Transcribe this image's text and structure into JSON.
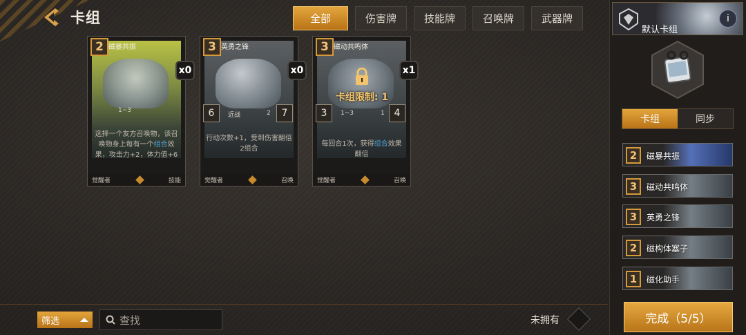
{
  "header": {
    "title": "卡组"
  },
  "tabs": [
    {
      "label": "全部",
      "active": true
    },
    {
      "label": "伤害牌",
      "active": false
    },
    {
      "label": "技能牌",
      "active": false
    },
    {
      "label": "召唤牌",
      "active": false
    },
    {
      "label": "武器牌",
      "active": false
    }
  ],
  "cards": [
    {
      "cost": "2",
      "name": "磁暴共振",
      "count": "x0",
      "range": "1~3",
      "desc_parts": [
        "选择一个友方召唤物，该召唤物身上每有一个",
        "组合",
        "效果，攻击力+2，体力值+6"
      ],
      "class_label": "觉醒者",
      "type_label": "技能"
    },
    {
      "cost": "3",
      "name": "英勇之锋",
      "count": "x0",
      "attack": "6",
      "defense": "7",
      "mode": "近战",
      "num": "2",
      "desc": "行动次数+1，受到伤害翻倍",
      "desc2": "2组合",
      "class_label": "觉醒者",
      "type_label": "召唤"
    },
    {
      "cost": "3",
      "name": "磁动共鸣体",
      "count": "x1",
      "attack": "3",
      "defense": "4",
      "range": "1~3",
      "num": "1",
      "desc_parts": [
        "每回合1次，获得",
        "组合",
        "效果翻倍"
      ],
      "class_label": "觉醒者",
      "type_label": "召唤",
      "lock_text": "卡组限制: 1"
    }
  ],
  "filter": {
    "label": "筛选"
  },
  "search": {
    "placeholder": "查找"
  },
  "unowned_label": "未拥有",
  "panel": {
    "deck_name": "默认卡组",
    "info_label": "i",
    "seg": [
      "卡组",
      "同步"
    ],
    "deck_items": [
      {
        "cost": "2",
        "name": "磁暴共振"
      },
      {
        "cost": "3",
        "name": "磁动共鸣体"
      },
      {
        "cost": "3",
        "name": "英勇之锋"
      },
      {
        "cost": "2",
        "name": "磁构体塞子"
      },
      {
        "cost": "1",
        "name": "磁化助手"
      }
    ],
    "done_label": "完成（5/5）"
  },
  "colors": {
    "accent": "#e4a53c",
    "panel": "#201d1b",
    "blue_text": "#4fa3d8"
  }
}
